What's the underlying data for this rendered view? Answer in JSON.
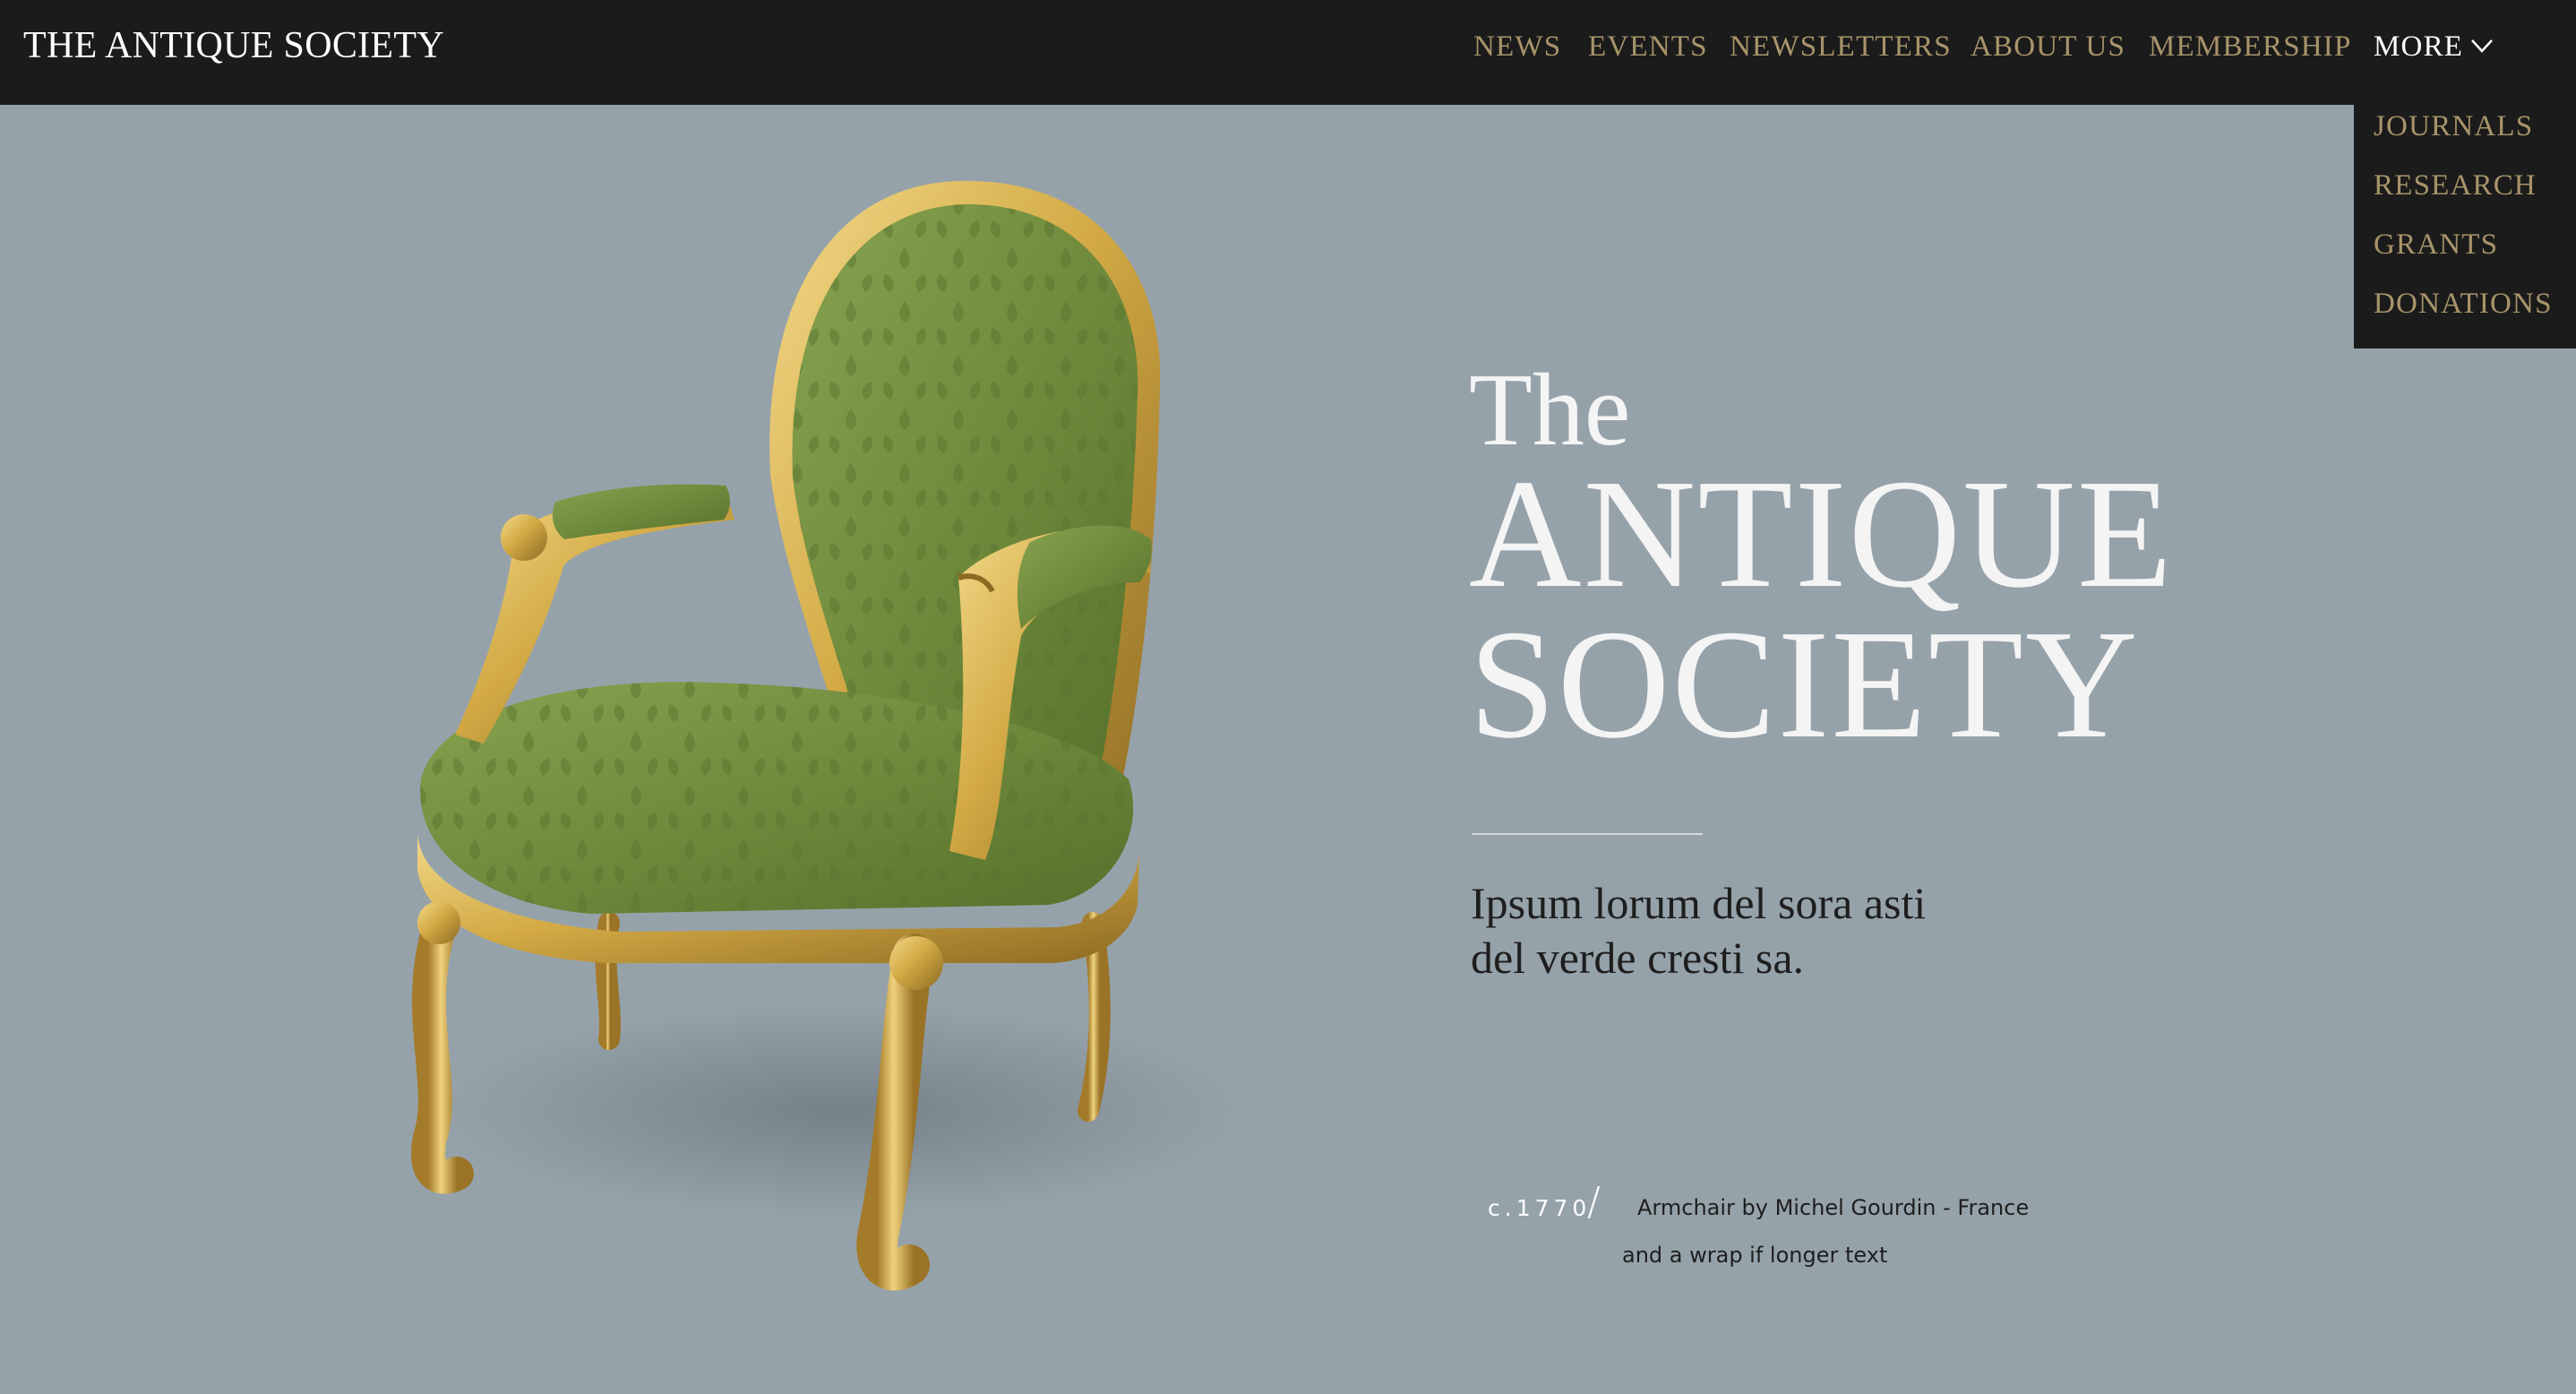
{
  "header": {
    "brand": "THE ANTIQUE SOCIETY",
    "nav": [
      "NEWS",
      "EVENTS",
      "NEWSLETTERS",
      "ABOUT US",
      "MEMBERSHIP"
    ],
    "more_label": "MORE",
    "more_icon": "chevron-down-icon",
    "dropdown": [
      "JOURNALS",
      "RESEARCH",
      "GRANTS",
      "DONATIONS"
    ]
  },
  "hero": {
    "pre_title": "The",
    "title_line1": "ANTIQUE",
    "title_line2": "SOCIETY",
    "tagline_line1": "Ipsum lorum del sora asti",
    "tagline_line2": "del verde cresti sa.",
    "image": "gilded-armchair-green-damask"
  },
  "caption": {
    "year": "c.1770",
    "separator": "/",
    "line1": "Armchair by Michel Gourdin - France",
    "line2": "and a wrap if longer text"
  },
  "colors": {
    "topbar": "#1b1b1b",
    "background": "#96a2aa",
    "nav_gold": "#a8946a",
    "white": "#ffffff",
    "dark_text": "#1e1e1e"
  }
}
